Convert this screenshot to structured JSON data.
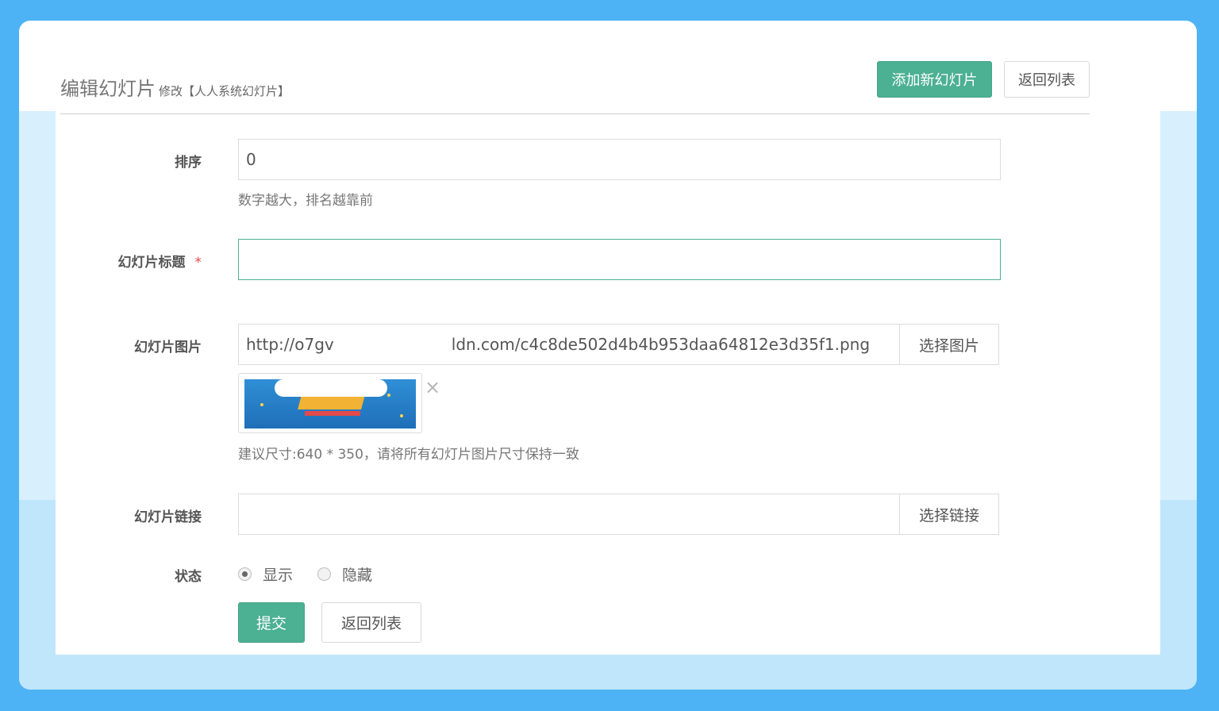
{
  "header": {
    "title": "编辑幻灯片",
    "subtitle": "修改【人人系统幻灯片】",
    "add_button": "添加新幻灯片",
    "back_button": "返回列表"
  },
  "form": {
    "order": {
      "label": "排序",
      "value": "0",
      "help": "数字越大，排名越靠前"
    },
    "title_field": {
      "label": "幻灯片标题",
      "required_mark": "*",
      "value": ""
    },
    "image": {
      "label": "幻灯片图片",
      "value_prefix": "http://o7gv",
      "value_suffix": "ldn.com/c4c8de502d4b4b953daa64812e3d35f1.png",
      "select_button": "选择图片",
      "remove_icon": "×",
      "help": "建议尺寸:640 * 350，请将所有幻灯片图片尺寸保持一致"
    },
    "link": {
      "label": "幻灯片链接",
      "value": "",
      "select_button": "选择链接"
    },
    "status": {
      "label": "状态",
      "options": [
        "显示",
        "隐藏"
      ],
      "selected": "显示"
    },
    "submit_button": "提交",
    "back_button": "返回列表"
  },
  "colors": {
    "page_background": "#4db3f5",
    "primary": "#4cb092",
    "required": "#e04b4b"
  }
}
